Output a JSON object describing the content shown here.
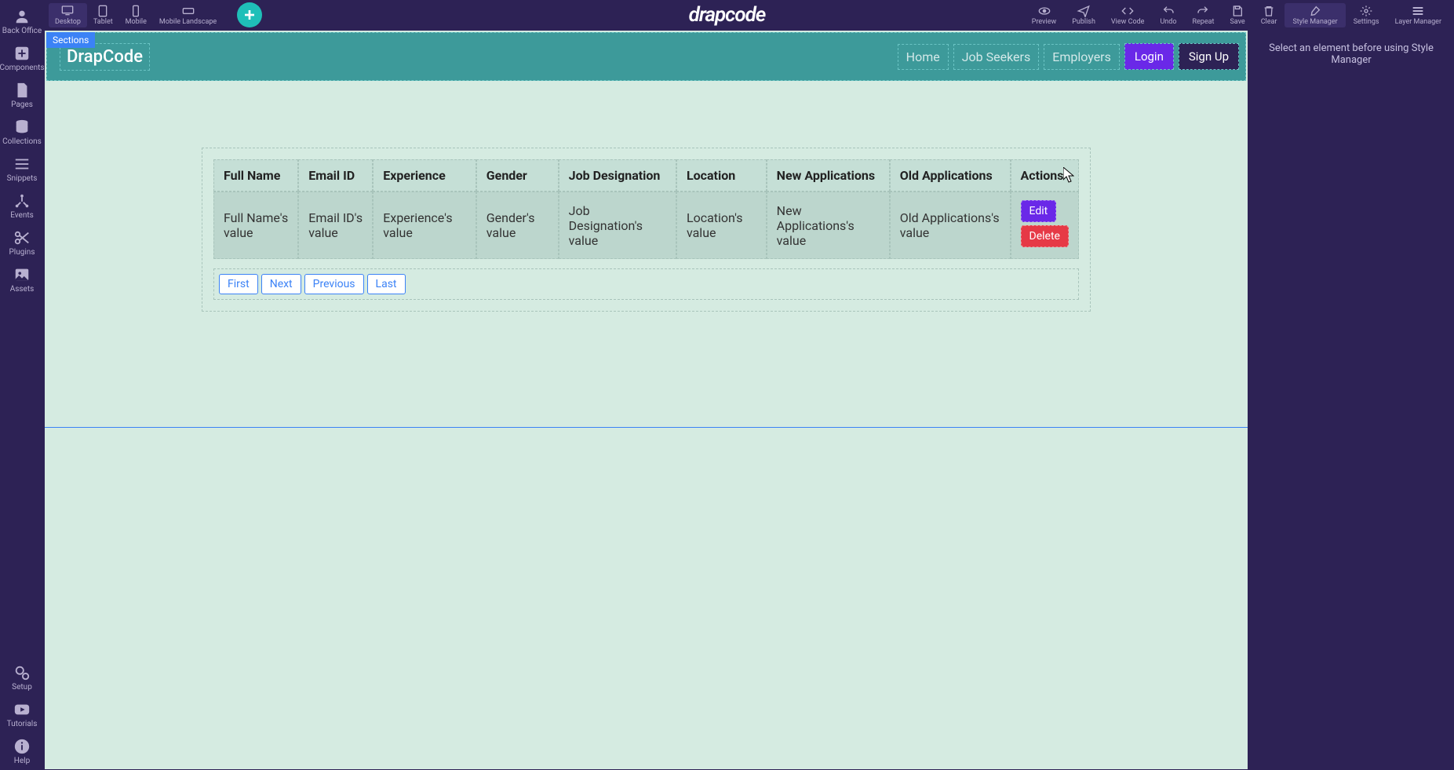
{
  "left_rail": {
    "back_office": "Back Office",
    "components": "Components",
    "pages": "Pages",
    "collections": "Collections",
    "snippets": "Snippets",
    "events": "Events",
    "plugins": "Plugins",
    "assets": "Assets",
    "setup": "Setup",
    "tutorials": "Tutorials",
    "help": "Help"
  },
  "top_bar": {
    "devices": {
      "desktop": "Desktop",
      "tablet": "Tablet",
      "mobile": "Mobile",
      "mobile_landscape": "Mobile Landscape"
    },
    "brand": "drapcode",
    "tools": {
      "preview": "Preview",
      "publish": "Publish",
      "view_code": "View Code",
      "undo": "Undo",
      "repeat": "Repeat",
      "save": "Save",
      "clear": "Clear",
      "style_manager": "Style Manager",
      "settings": "Settings",
      "layer_manager": "Layer Manager"
    }
  },
  "canvas": {
    "sections_tag": "Sections",
    "nav_logo": "DrapCode",
    "nav": {
      "home": "Home",
      "job_seekers": "Job Seekers",
      "employers": "Employers",
      "login": "Login",
      "signup": "Sign Up"
    },
    "table": {
      "headers": {
        "full_name": "Full Name",
        "email": "Email ID",
        "experience": "Experience",
        "gender": "Gender",
        "job_designation": "Job Designation",
        "location": "Location",
        "new_apps": "New Applications",
        "old_apps": "Old Applications",
        "actions": "Actions"
      },
      "row": {
        "full_name": "Full Name's value",
        "email": "Email ID's value",
        "experience": "Experience's value",
        "gender": "Gender's value",
        "job_designation": "Job Designation's value",
        "location": "Location's value",
        "new_apps": "New Applications's value",
        "old_apps": "Old Applications's value"
      },
      "actions": {
        "edit": "Edit",
        "delete": "Delete"
      }
    },
    "pagination": {
      "first": "First",
      "next": "Next",
      "previous": "Previous",
      "last": "Last"
    }
  },
  "right_panel": {
    "empty_msg": "Select an element before using Style Manager"
  }
}
